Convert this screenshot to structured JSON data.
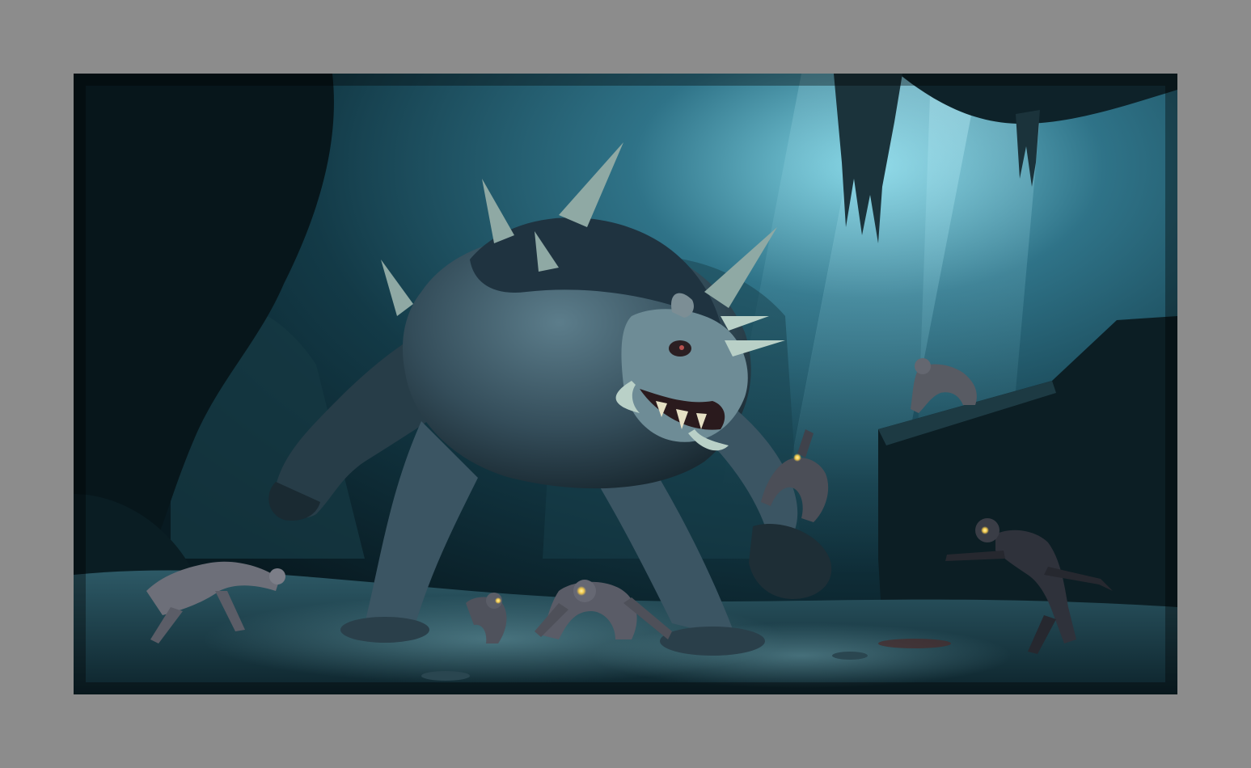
{
  "scene": {
    "subject": "artwork",
    "frame_color": "#8c8c8c",
    "palette": {
      "shadow": "#07161c",
      "cave": "#0f2a33",
      "mist": "#3d7f8f",
      "light": "#8fe2f0",
      "creature": "#3e5866",
      "creature_dark": "#1c2e38",
      "horn": "#9fb8b0",
      "eye": "#f2c94c"
    }
  }
}
